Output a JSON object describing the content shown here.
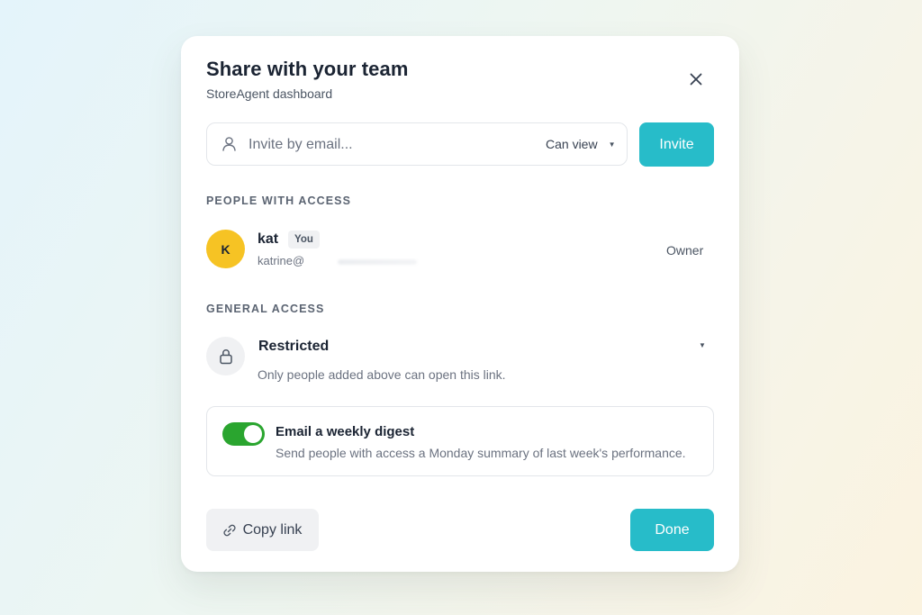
{
  "dialog": {
    "title": "Share with your team",
    "subtitle": "StoreAgent dashboard"
  },
  "invite": {
    "placeholder": "Invite by email...",
    "permission": "Can view",
    "button_label": "Invite"
  },
  "people_section": {
    "label": "PEOPLE WITH ACCESS",
    "people": [
      {
        "initial": "K",
        "name": "kat",
        "badge": "You",
        "email": "katrine@",
        "role": "Owner"
      }
    ]
  },
  "general_access": {
    "label": "GENERAL ACCESS",
    "level": "Restricted",
    "description": "Only people added above can open this link."
  },
  "digest": {
    "title": "Email a weekly digest",
    "description": "Send people with access a Monday summary of last week's performance.",
    "enabled": true
  },
  "footer": {
    "copy_link_label": "Copy link",
    "done_label": "Done"
  },
  "colors": {
    "accent": "#27bcc9",
    "toggle_on": "#2aa52f",
    "avatar": "#f6c324"
  }
}
